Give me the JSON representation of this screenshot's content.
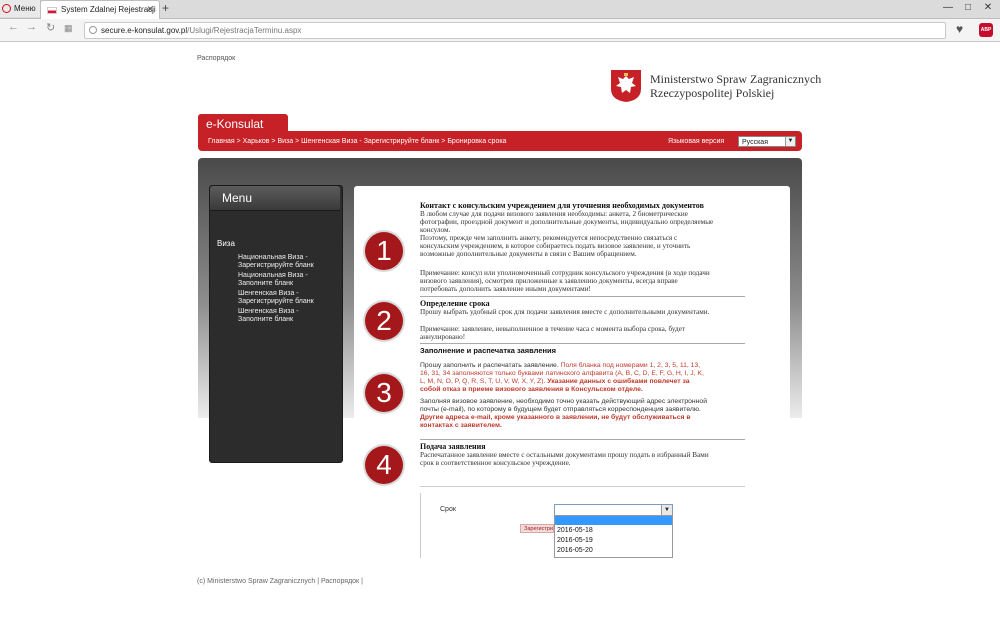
{
  "browser": {
    "menu_label": "Меню",
    "tab_title": "System Zdalnej Rejestracji",
    "tab_close": "✕",
    "new_tab": "+",
    "url_domain": "secure.e-konsulat.gov.pl",
    "url_path": "/Uslugi/RejestracjaTerminu.aspx",
    "controls": [
      "—",
      "□",
      "✕"
    ]
  },
  "header": {
    "rasporadok": "Распорядок",
    "ministry_line1": "Ministerstwo Spraw Zagranicznych",
    "ministry_line2": "Rzeczypospolitej Polskiej",
    "ekonsulat": "e-Konsulat",
    "breadcrumb": "Главная > Харьков > Виза > Шенгенская Виза - Зарегистрируйте бланк > Бронировка срока",
    "language_label": "Языковая версия",
    "language_value": "Русская"
  },
  "sidebar": {
    "title": "Menu",
    "section": "Виза",
    "links": [
      [
        "Национальная Виза -",
        "Зарегистрируйте бланк"
      ],
      [
        "Национальная Виза -",
        "Заполните бланк"
      ],
      [
        "Шенгенская Виза -",
        "Зарегистрируйте бланк"
      ],
      [
        "Шенгенская Виза -",
        "Заполните бланк"
      ]
    ]
  },
  "steps": {
    "numbers": [
      "1",
      "2",
      "3",
      "4"
    ],
    "s1": {
      "title": "Контакт с консульским учреждением для уточнения необходимых документов",
      "lines": [
        "В любом случае для подачи визового заявления необходимы: анкета, 2 биометрические",
        "фотографии, проездной документ и дополнительные документы, индивидуально определяемые",
        "консулом.",
        "Поэтому, прежде чем заполнить анкету, рекомендуется непосредственно связаться с",
        "консульским учреждением, в которое собираетесь подать визовое заявление, и уточнить",
        "возможные дополнительные документы в связи с Вашим обращением."
      ],
      "note": [
        "Примечание: консул или уполномоченный сотрудник консульского учреждения (в ходе подачи",
        "визового заявления), осмотрев приложенные к заявлению документы, всегда вправе",
        "потребовать дополнить заявление иными документами!"
      ]
    },
    "s2": {
      "title": "Определение срока",
      "line": "Прошу выбрать удобный срок для подачи заявления вместе с дополнительными документами.",
      "note": [
        "Примечание: заявление, невыполненное в течение часа с момента выбора срока, будет",
        "аннулировано!"
      ]
    },
    "s3": {
      "title": "Заполнение и распечатка заявления",
      "p1_start": "Прошу заполнить и распечатать заявление. ",
      "p1_red": "Поля бланка под номерами 1, 2, 3, 5, 11, 13,",
      "p1_line2": "16, 31, 34 заполняются только буквами латинского алфавита (A, B, C, D, E, F, G, H, I, J, K,",
      "p1_line3_red": "L, M, N, O, P, Q, R, S, T, U, V, W, X, Y, Z). ",
      "p1_line3_bold": "Указание данных с ошибками повлечет за",
      "p1_line4_bold": "собой отказ в приеме визового заявления в Консульском отделе.",
      "p2_line1": "Заполняя визовое заявление, необходимо точно указать действующий адрес электронной",
      "p2_line2": "почты (e-mail), по которому в будущем будет отправляться корреспонденция  заявителю.",
      "p2_line3_bold": "Другие адреса e-mail, кроме указанного в заявлении, не будут обслуживаться в",
      "p2_line4_bold": "контактах с заявителем."
    },
    "s4": {
      "title": "Подача заявления",
      "lines": [
        "Распечатанное заявление вместе с остальными документами прошу подать в избранный Вами",
        "срок в соответственное консульское учреждение."
      ]
    }
  },
  "form": {
    "srok_label": "Срок",
    "selected": "",
    "options": [
      "2016-05-18",
      "2016-05-19",
      "2016-05-20"
    ],
    "register_button": "Зарегистрировать"
  },
  "footer": {
    "text": "(c) Ministerstwo Spraw Zagranicznych | Распорядок |"
  },
  "colors": {
    "brand_red": "#c52126",
    "circle_red": "#a4171b",
    "dropdown_highlight": "#3399ff"
  }
}
